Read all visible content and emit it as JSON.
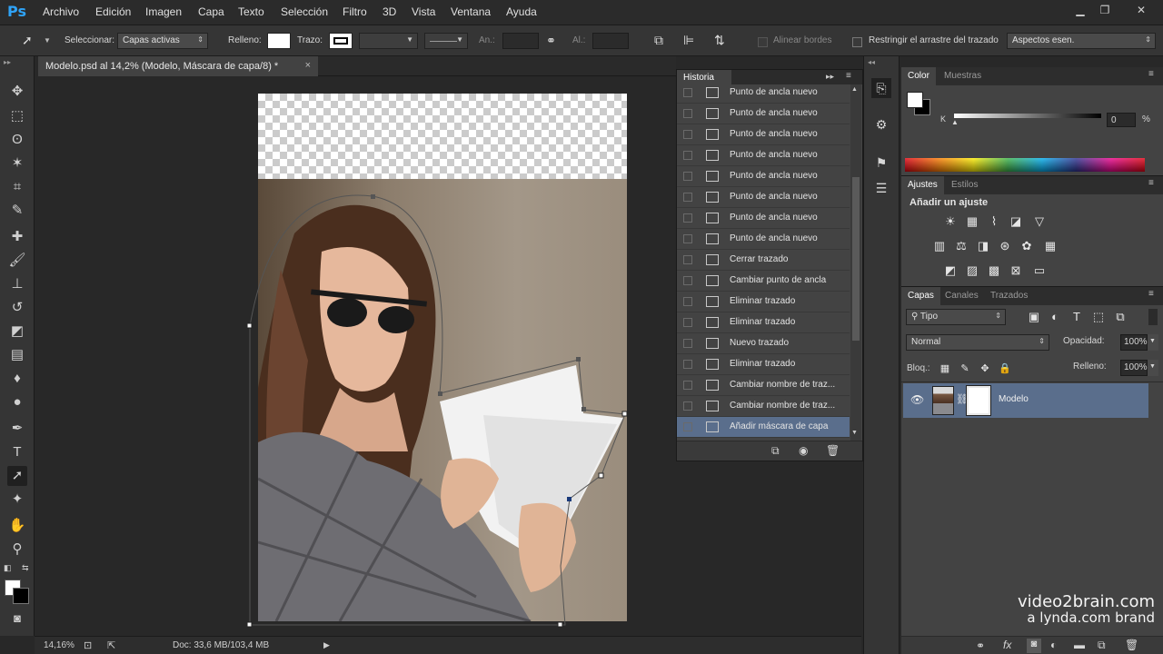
{
  "app": {
    "logo": "Ps",
    "menu": [
      "Archivo",
      "Edición",
      "Imagen",
      "Capa",
      "Texto",
      "Selección",
      "Filtro",
      "3D",
      "Vista",
      "Ventana",
      "Ayuda"
    ],
    "window_controls": [
      "minimize-icon",
      "restore-icon",
      "close-icon"
    ]
  },
  "options_bar": {
    "select_label": "Seleccionar:",
    "select_value": "Capas activas",
    "fill_label": "Relleno:",
    "stroke_label": "Trazo:",
    "width_label": "An.:",
    "height_label": "Al.:",
    "align_edges_label": "Alinear bordes",
    "restrict_label": "Restringir el arrastre del trazado",
    "essentials_value": "Aspectos esen."
  },
  "document": {
    "tab_title": "Modelo.psd al 14,2% (Modelo, Máscara de capa/8) *",
    "close_symbol": "×"
  },
  "status_bar": {
    "zoom": "14,16%",
    "doc_info": "Doc: 33,6 MB/103,4 MB"
  },
  "history": {
    "title": "Historia",
    "items": [
      "Punto de ancla nuevo",
      "Punto de ancla nuevo",
      "Punto de ancla nuevo",
      "Punto de ancla nuevo",
      "Punto de ancla nuevo",
      "Punto de ancla nuevo",
      "Punto de ancla nuevo",
      "Punto de ancla nuevo",
      "Cerrar trazado",
      "Cambiar punto de ancla",
      "Eliminar trazado",
      "Eliminar trazado",
      "Nuevo trazado",
      "Eliminar trazado",
      "Cambiar nombre de traz...",
      "Cambiar nombre de traz...",
      "Añadir máscara de capa"
    ],
    "selected_index": 16
  },
  "color_panel": {
    "tabs": [
      "Color",
      "Muestras"
    ],
    "channel_label": "K",
    "channel_value": "0",
    "unit": "%"
  },
  "adjustments_panel": {
    "tabs": [
      "Ajustes",
      "Estilos"
    ],
    "heading": "Añadir un ajuste"
  },
  "layers_panel": {
    "tabs": [
      "Capas",
      "Canales",
      "Trazados"
    ],
    "filter_value": "Tipo",
    "blend_mode": "Normal",
    "opacity_label": "Opacidad:",
    "opacity_value": "100%",
    "lock_label": "Bloq.:",
    "fill_label": "Relleno:",
    "fill_value": "100%",
    "layers": [
      {
        "name": "Modelo",
        "visible": true,
        "has_mask": true
      }
    ]
  },
  "watermark": {
    "line1": "video2brain.com",
    "line2": "a lynda.com brand"
  },
  "colors": {
    "ps_blue": "#2fa3f7",
    "selected_row": "#5a6e8c",
    "panel_bg": "#434343"
  }
}
